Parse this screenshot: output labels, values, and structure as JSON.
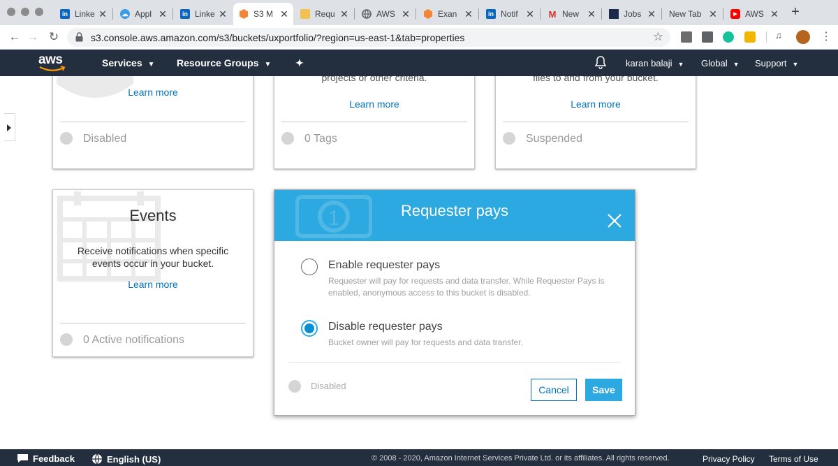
{
  "browser": {
    "tabs": [
      {
        "label": "Linke",
        "icon": "linkedin-icon",
        "active": false
      },
      {
        "label": "Appl",
        "icon": "cloud-icon",
        "active": false
      },
      {
        "label": "Linke",
        "icon": "linkedin-icon",
        "active": false
      },
      {
        "label": "S3 M",
        "icon": "aws-s3-icon",
        "active": true
      },
      {
        "label": "Requ",
        "icon": "box-icon",
        "active": false
      },
      {
        "label": "AWS",
        "icon": "globe-icon",
        "active": false
      },
      {
        "label": "Exan",
        "icon": "aws-hex-icon",
        "active": false
      },
      {
        "label": "Notif",
        "icon": "linkedin-icon",
        "active": false
      },
      {
        "label": "New",
        "icon": "gmail-icon",
        "active": false
      },
      {
        "label": "Jobs",
        "icon": "jobs-icon",
        "active": false
      },
      {
        "label": "New Tab",
        "icon": "",
        "active": false
      },
      {
        "label": "AWS",
        "icon": "youtube-icon",
        "active": false
      }
    ],
    "url": "s3.console.aws.amazon.com/s3/buckets/uxportfolio/?region=us-east-1&tab=properties"
  },
  "nav": {
    "services": "Services",
    "resource_groups": "Resource Groups",
    "user": "karan balaji",
    "region": "Global",
    "support": "Support"
  },
  "cards": {
    "card1": {
      "learn": "Learn more",
      "status": "Disabled"
    },
    "card2": {
      "partial_desc": "projects or other criteria.",
      "learn": "Learn more",
      "status": "0 Tags"
    },
    "card3": {
      "partial_desc": "files to and from your bucket.",
      "learn": "Learn more",
      "status": "Suspended"
    },
    "events": {
      "title": "Events",
      "desc": "Receive notifications when specific events occur in your bucket.",
      "learn": "Learn more",
      "status": "0 Active notifications"
    }
  },
  "modal": {
    "title": "Requester pays",
    "options": [
      {
        "label": "Enable requester pays",
        "desc": "Requester will pay for requests and data transfer. While Requester Pays is enabled, anonymous access to this bucket is disabled.",
        "checked": false
      },
      {
        "label": "Disable requester pays",
        "desc": "Bucket owner will pay for requests and data transfer.",
        "checked": true
      }
    ],
    "status": "Disabled",
    "cancel": "Cancel",
    "save": "Save"
  },
  "footer": {
    "feedback": "Feedback",
    "language": "English (US)",
    "copyright": "© 2008 - 2020, Amazon Internet Services Private Ltd. or its affiliates. All rights reserved.",
    "privacy": "Privacy Policy",
    "terms": "Terms of Use"
  },
  "colors": {
    "aws_nav": "#232f3e",
    "modal_header": "#2ba9e0",
    "link": "#0073bb"
  }
}
